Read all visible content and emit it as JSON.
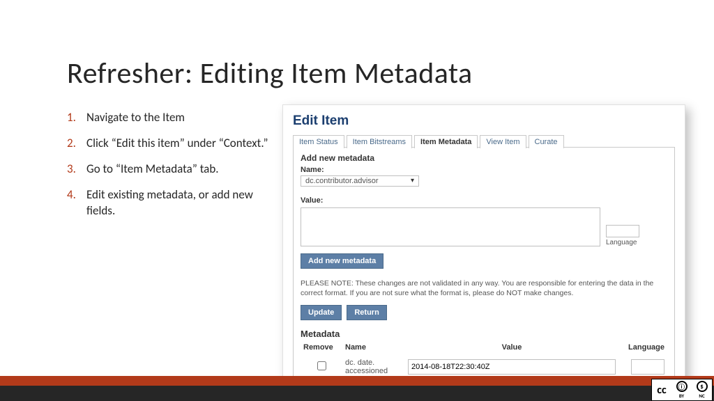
{
  "title": "Refresher: Editing Item Metadata",
  "steps": [
    "Navigate to the Item",
    "Click “Edit this item” under “Context.”",
    "Go to “Item Metadata” tab.",
    "Edit existing metadata, or add new fields."
  ],
  "shot": {
    "title": "Edit Item",
    "tabs": [
      "Item Status",
      "Item Bitstreams",
      "Item Metadata",
      "View Item",
      "Curate"
    ],
    "active_tab": 2,
    "section": "Add new metadata",
    "name_label": "Name:",
    "name_value": "dc.contributor.advisor",
    "value_label": "Value:",
    "lang_label": "Language",
    "add_btn": "Add new metadata",
    "note": "PLEASE NOTE: These changes are not validated in any way. You are responsible for entering the data in the correct format. If you are not sure what the format is, please do NOT make changes.",
    "update_btn": "Update",
    "return_btn": "Return",
    "metadata_hdr": "Metadata",
    "cols": {
      "remove": "Remove",
      "name": "Name",
      "value": "Value",
      "language": "Language"
    },
    "row": {
      "name": "dc. date. accessioned",
      "value": "2014-08-18T22:30:40Z"
    }
  },
  "cc": {
    "logo": "cc",
    "by": "BY",
    "nc": "NC",
    "person": "ⓘ",
    "dollar": "$"
  }
}
